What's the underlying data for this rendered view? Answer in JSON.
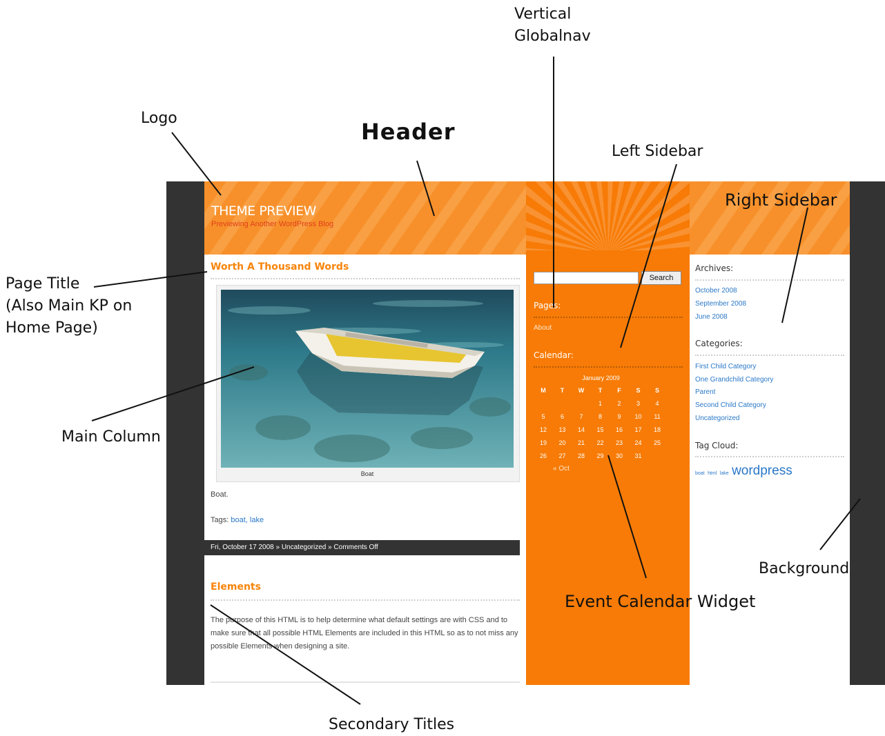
{
  "annotations": {
    "vertical_globalnav": "Vertical\nGlobalnav",
    "logo": "Logo",
    "header": "Header",
    "left_sidebar": "Left Sidebar",
    "right_sidebar": "Right Sidebar",
    "page_title": "Page Title\n(Also Main KP on\nHome Page)",
    "main_column": "Main Column",
    "background": "Background",
    "event_calendar_widget": "Event Calendar Widget",
    "secondary_titles": "Secondary Titles"
  },
  "site": {
    "title": "THEME PREVIEW",
    "tagline": "Previewing Another WordPress Blog"
  },
  "post": {
    "title": "Worth A Thousand Words",
    "image_caption": "Boat",
    "body": "Boat.",
    "tags_label": "Tags:",
    "tags": "boat, lake",
    "meta": "Fri, October 17 2008 » Uncategorized » Comments Off"
  },
  "post2": {
    "title": "Elements",
    "body": "The purpose of this HTML is to help determine what default settings are with CSS and to make sure that all possible HTML Elements are included in this HTML so as to not miss any possible Elements when designing a site."
  },
  "left_sidebar": {
    "search_button": "Search",
    "search_value": "",
    "pages_title": "Pages:",
    "pages": [
      "About"
    ],
    "calendar_title": "Calendar:",
    "calendar": {
      "caption": "January 2009",
      "days": [
        "M",
        "T",
        "W",
        "T",
        "F",
        "S",
        "S"
      ],
      "weeks": [
        [
          "",
          "",
          "",
          "1",
          "2",
          "3",
          "4"
        ],
        [
          "5",
          "6",
          "7",
          "8",
          "9",
          "10",
          "11"
        ],
        [
          "12",
          "13",
          "14",
          "15",
          "16",
          "17",
          "18"
        ],
        [
          "19",
          "20",
          "21",
          "22",
          "23",
          "24",
          "25"
        ],
        [
          "26",
          "27",
          "28",
          "29",
          "30",
          "31",
          ""
        ]
      ],
      "prev_link": "« Oct"
    }
  },
  "right_sidebar": {
    "archives_title": "Archives:",
    "archives": [
      "October 2008",
      "September 2008",
      "June 2008"
    ],
    "categories_title": "Categories:",
    "categories": [
      "First Child Category",
      "One Grandchild Category",
      "Parent",
      "Second Child Category",
      "Uncategorized"
    ],
    "tagcloud_title": "Tag Cloud:",
    "tags_small": [
      "boat",
      "html",
      "lake"
    ],
    "tag_big": "wordpress"
  }
}
